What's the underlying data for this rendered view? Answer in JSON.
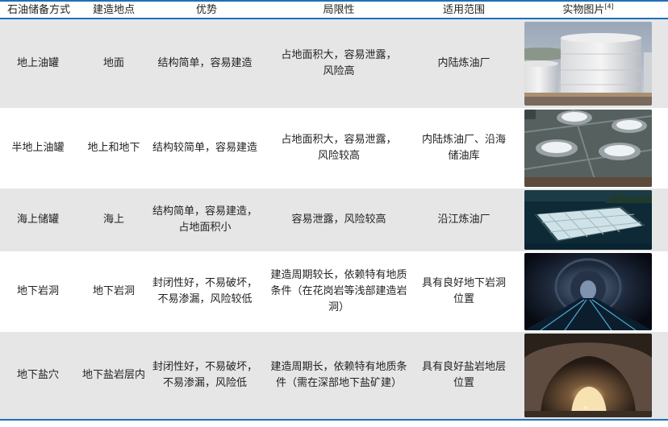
{
  "headers": [
    "石油储备方式",
    "建造地点",
    "优势",
    "局限性",
    "适用范围",
    "实物图片"
  ],
  "header_ref": "[4]",
  "rows": [
    {
      "method": "地上油罐",
      "site": "地面",
      "advantage": [
        "结构简单，容易建造"
      ],
      "limitation": [
        "占地面积大，容易泄露，",
        "风险高"
      ],
      "scope": [
        "内陆炼油厂"
      ],
      "image": "tank-farm-photo"
    },
    {
      "method": "半地上油罐",
      "site": "地上和地下",
      "advantage": [
        "结构较简单，容易建造"
      ],
      "limitation": [
        "占地面积大，容易泄露，",
        "风险较高"
      ],
      "scope": [
        "内陆炼油厂、沿海",
        "储油库"
      ],
      "image": "semi-buried-tanks-photo"
    },
    {
      "method": "海上储罐",
      "site": "海上",
      "advantage": [
        "结构简单，容易建造，",
        "占地面积小"
      ],
      "limitation": [
        "容易泄露，风险较高"
      ],
      "scope": [
        "沿江炼油厂"
      ],
      "image": "offshore-storage-photo"
    },
    {
      "method": "地下岩洞",
      "site": "地下岩洞",
      "advantage": [
        "封闭性好，不易破坏，",
        "不易渗漏，风险较低"
      ],
      "limitation": [
        "建造周期较长，依赖特有地质",
        "条件（在花岗岩等浅部建造岩",
        "洞）"
      ],
      "scope": [
        "具有良好地下岩洞",
        "位置"
      ],
      "image": "rock-cavern-photo"
    },
    {
      "method": "地下盐穴",
      "site": "地下盐岩层内",
      "advantage": [
        "封闭性好，不易破坏，",
        "不易渗漏，风险低"
      ],
      "limitation": [
        "建造周期长，依赖特有地质条",
        "件（需在深部地下盐矿建）"
      ],
      "scope": [
        "具有良好盐岩地层",
        "位置"
      ],
      "image": "salt-cavern-photo"
    }
  ],
  "colors": {
    "accent": "#1e6fb8",
    "shade": "#e6e6e6"
  }
}
